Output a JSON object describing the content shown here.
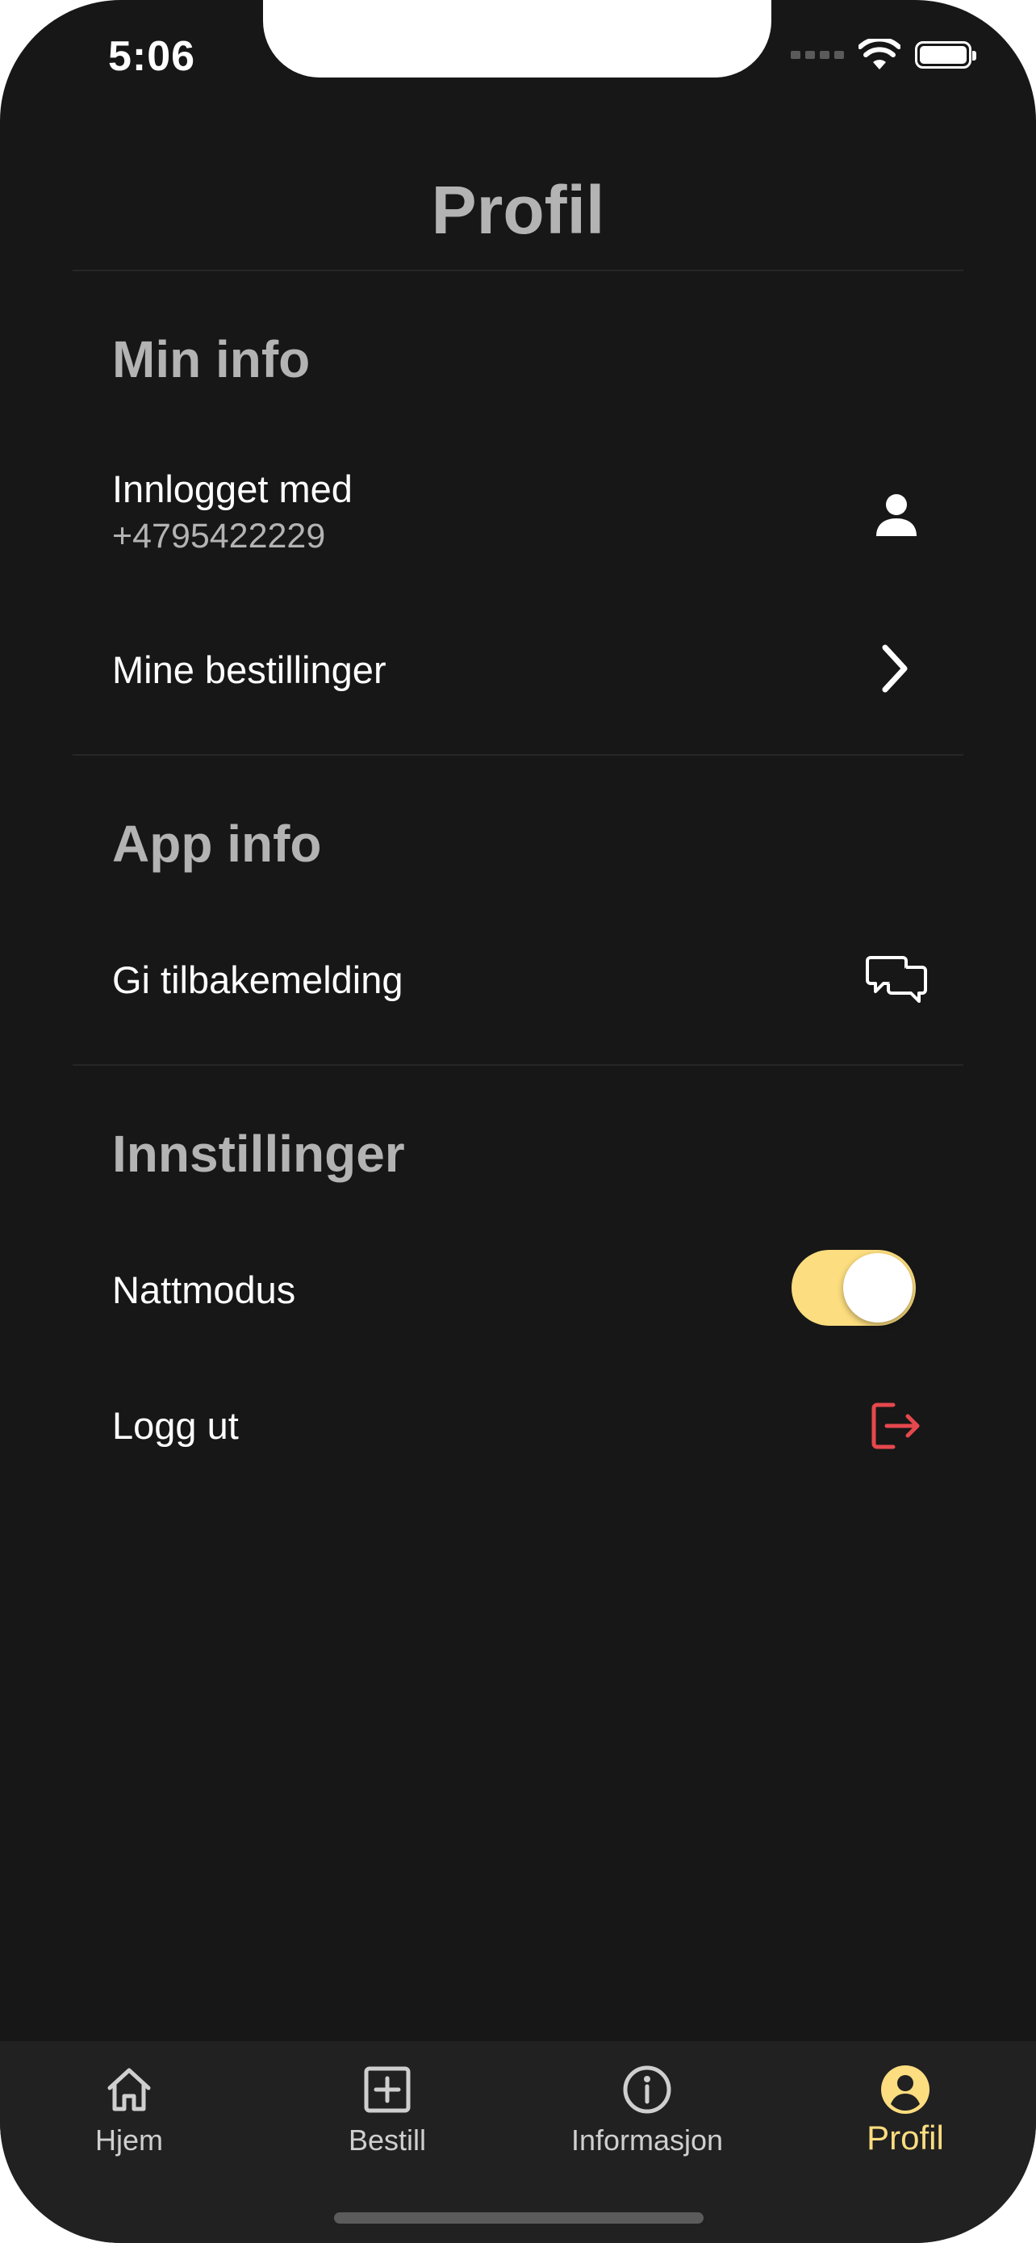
{
  "status_bar": {
    "time": "5:06"
  },
  "header": {
    "title": "Profil"
  },
  "sections": {
    "min_info": {
      "title": "Min info",
      "logged_in_label": "Innlogget med",
      "logged_in_value": "+4795422229",
      "orders_label": "Mine bestillinger"
    },
    "app_info": {
      "title": "App info",
      "feedback_label": "Gi tilbakemelding"
    },
    "settings": {
      "title": "Innstillinger",
      "night_mode_label": "Nattmodus",
      "night_mode_on": true,
      "logout_label": "Logg ut"
    }
  },
  "tabbar": {
    "items": [
      {
        "label": "Hjem",
        "icon": "home-icon",
        "active": false
      },
      {
        "label": "Bestill",
        "icon": "plus-square-icon",
        "active": false
      },
      {
        "label": "Informasjon",
        "icon": "info-icon",
        "active": false
      },
      {
        "label": "Profil",
        "icon": "profile-icon",
        "active": true
      }
    ]
  },
  "colors": {
    "background": "#171717",
    "accent": "#fcdd7f",
    "logout": "#e5484d",
    "tabbar": "#212121"
  }
}
